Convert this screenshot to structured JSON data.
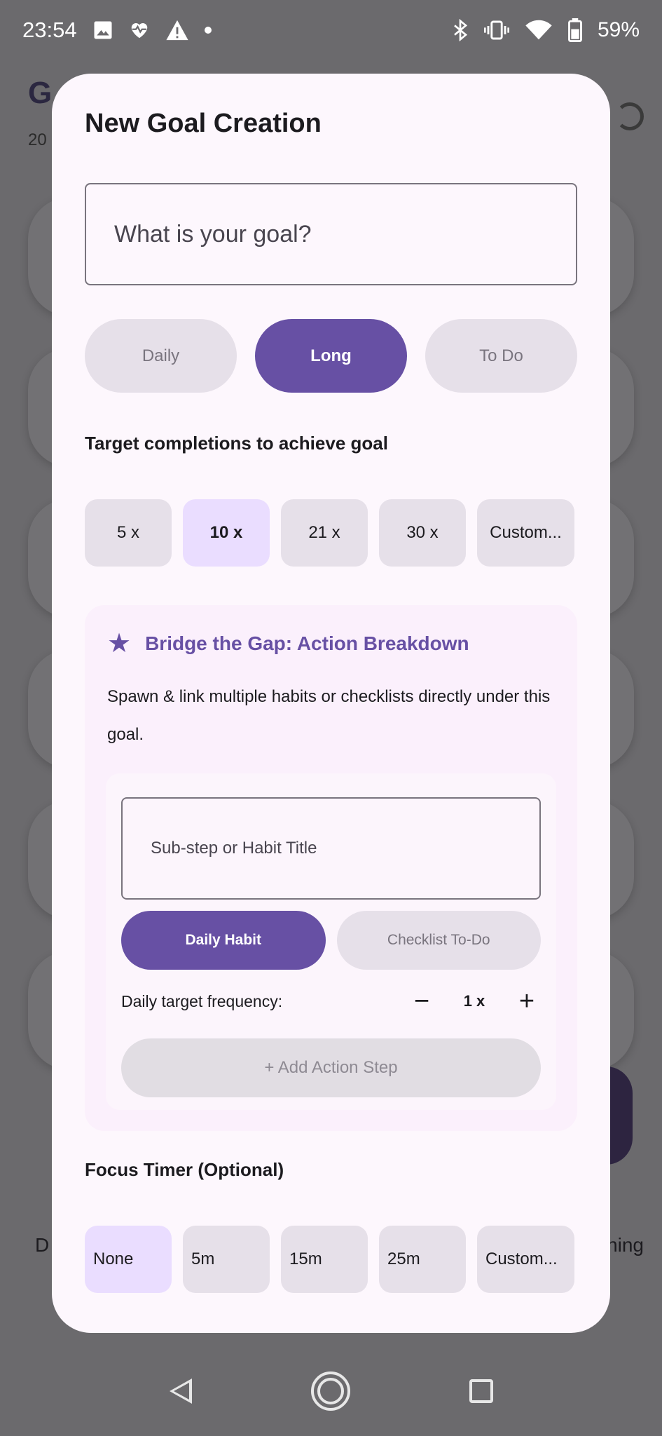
{
  "status_bar": {
    "time": "23:54",
    "battery": "59%",
    "left_icons": [
      "image-icon",
      "heart-pulse-icon",
      "warning-icon",
      "dot-icon"
    ],
    "right_icons": [
      "bluetooth-icon",
      "vibrate-icon",
      "wifi-icon",
      "battery-icon"
    ]
  },
  "background": {
    "title": "G",
    "date": "20",
    "nav_left": "D",
    "nav_right": "ning"
  },
  "dialog": {
    "title": "New Goal Creation",
    "goal_placeholder": "What is your goal?",
    "goal_types": [
      {
        "label": "Daily",
        "active": false
      },
      {
        "label": "Long",
        "active": true
      },
      {
        "label": "To Do",
        "active": false
      }
    ],
    "target_label": "Target completions to achieve goal",
    "target_options": [
      {
        "label": "5 x",
        "selected": false
      },
      {
        "label": "10 x",
        "selected": true
      },
      {
        "label": "21 x",
        "selected": false
      },
      {
        "label": "30 x",
        "selected": false
      },
      {
        "label": "Custom...",
        "selected": false
      }
    ],
    "bridge": {
      "icon": "star-icon",
      "title": "Bridge the Gap: Action Breakdown",
      "description": "Spawn & link multiple habits or checklists directly under this goal.",
      "substep_placeholder": "Sub-step or Habit Title",
      "kinds": [
        {
          "label": "Daily Habit",
          "active": true
        },
        {
          "label": "Checklist To-Do",
          "active": false
        }
      ],
      "frequency_label": "Daily target frequency:",
      "frequency_value": "1 x",
      "add_label": "+ Add Action Step"
    },
    "timer_label": "Focus Timer (Optional)",
    "timer_options": [
      {
        "label": "None",
        "selected": true
      },
      {
        "label": "5m",
        "selected": false
      },
      {
        "label": "15m",
        "selected": false
      },
      {
        "label": "25m",
        "selected": false
      },
      {
        "label": "Custom...",
        "selected": false
      }
    ]
  },
  "colors": {
    "primary": "#6750a4",
    "chip_selected": "#eaddff",
    "chip": "#e6e0e9",
    "dialog_bg": "#fdf7fd",
    "scrim": "#6b6a6d"
  }
}
